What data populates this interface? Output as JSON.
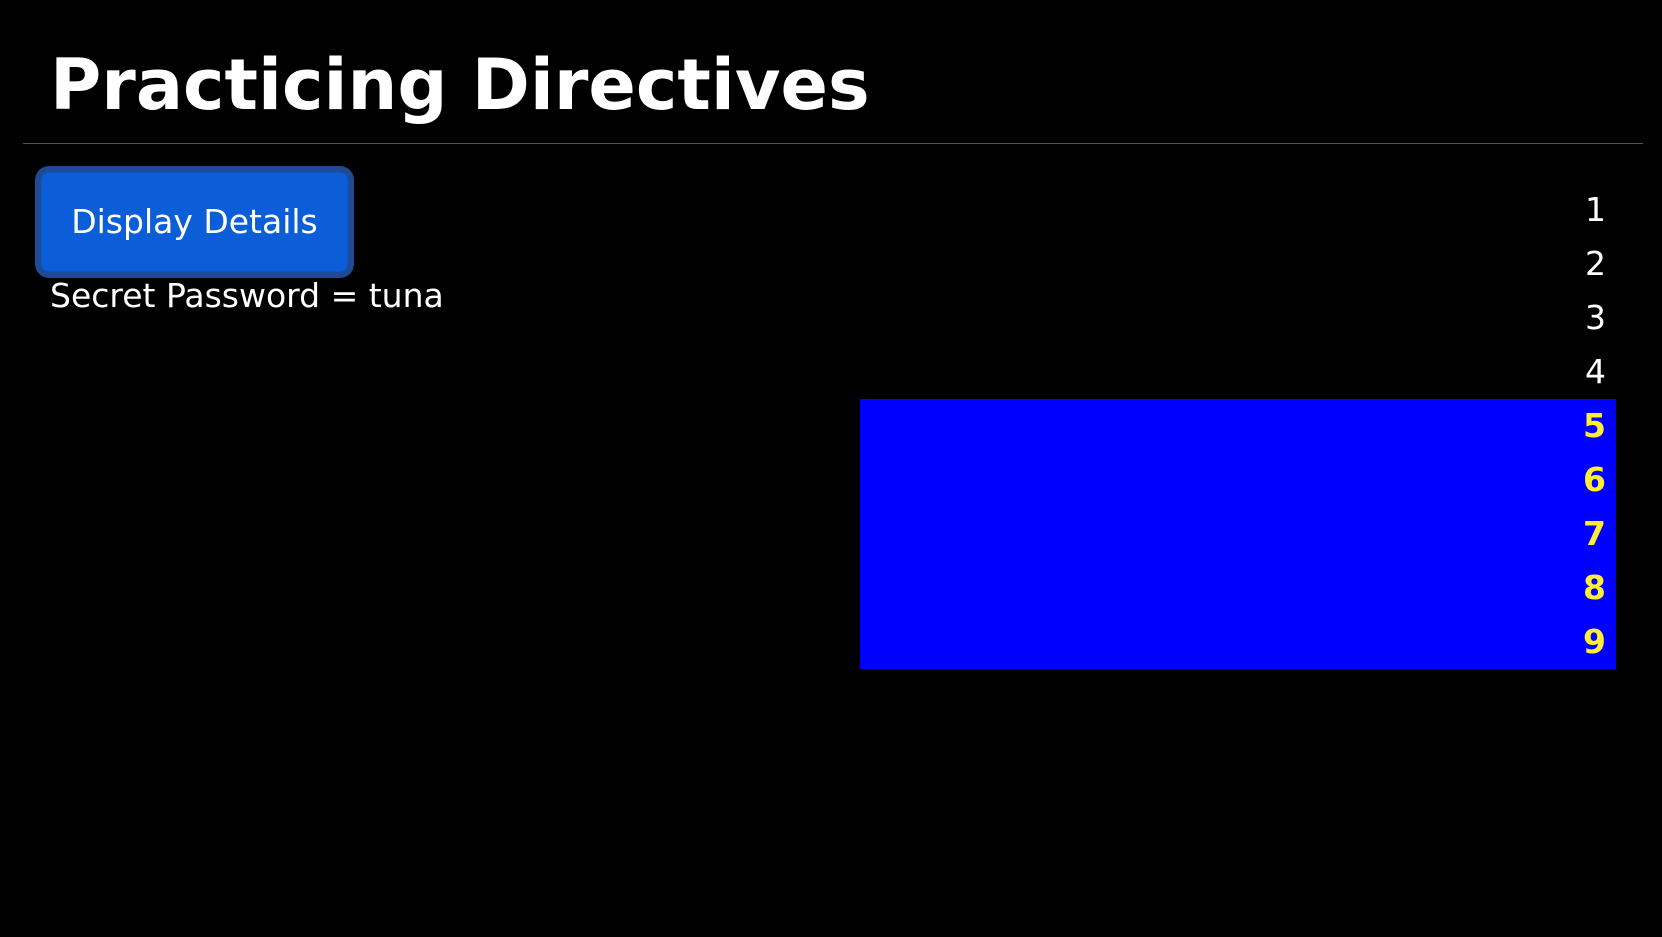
{
  "page": {
    "title": "Practicing Directives"
  },
  "details_button": {
    "label": "Display Details"
  },
  "secret": {
    "text": "Secret Password = tuna"
  },
  "numbers": {
    "items": [
      {
        "label": "1",
        "highlighted": false
      },
      {
        "label": "2",
        "highlighted": false
      },
      {
        "label": "3",
        "highlighted": false
      },
      {
        "label": "4",
        "highlighted": false
      },
      {
        "label": "5",
        "highlighted": true
      },
      {
        "label": "6",
        "highlighted": true
      },
      {
        "label": "7",
        "highlighted": true
      },
      {
        "label": "8",
        "highlighted": true
      },
      {
        "label": "9",
        "highlighted": true
      }
    ],
    "highlight_background": "#0000ff",
    "highlight_text_color": "#ffee33"
  },
  "colors": {
    "background": "#000000",
    "text": "#ffffff",
    "button": "#0b5ed7"
  }
}
